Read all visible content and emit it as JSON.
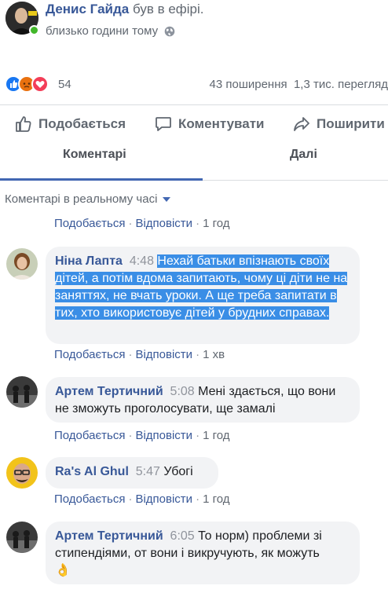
{
  "post": {
    "author": "Денис Гайда",
    "status": "був в ефірі.",
    "time": "близько години тому",
    "reactions_count": "54",
    "shares": "43 поширення",
    "views": "1,3 тис. перегляд"
  },
  "actions": {
    "like": "Подобається",
    "comment": "Коментувати",
    "share": "Поширити"
  },
  "tabs": {
    "comments": "Коментарі",
    "next": "Далі"
  },
  "live_comments_label": "Коментарі в реальному часі",
  "comment_actions": {
    "like": "Подобається",
    "reply": "Відповісти"
  },
  "comments": [
    {
      "meta_time": "1 год"
    },
    {
      "name": "Ніна Лапта",
      "time": "4:48",
      "text": "Нехай батьки впізнають своїх дітей, а потім вдома запитають, чому ці діти не на заняттях, не вчать уроки. А ще треба запитати в тих, хто використовує дітей у брудних справах.",
      "meta_time": "1 хв"
    },
    {
      "name": "Артем Тертичний",
      "time": "5:08",
      "text": "Мені здається, що вони не зможуть проголосувати, ще замалі",
      "meta_time": "1 год"
    },
    {
      "name": "Ra's Al Ghul",
      "time": "5:47",
      "text": "Убогі",
      "meta_time": "1 год"
    },
    {
      "name": "Артем Тертичний",
      "time": "6:05",
      "text": "То норм) проблеми зі стипендіями, от вони і викручують, як можуть",
      "emoji": "👌"
    }
  ],
  "colors": {
    "link": "#385898",
    "highlight": "#3a8ee6",
    "bubble": "#f2f3f5",
    "online": "#42b72a"
  }
}
